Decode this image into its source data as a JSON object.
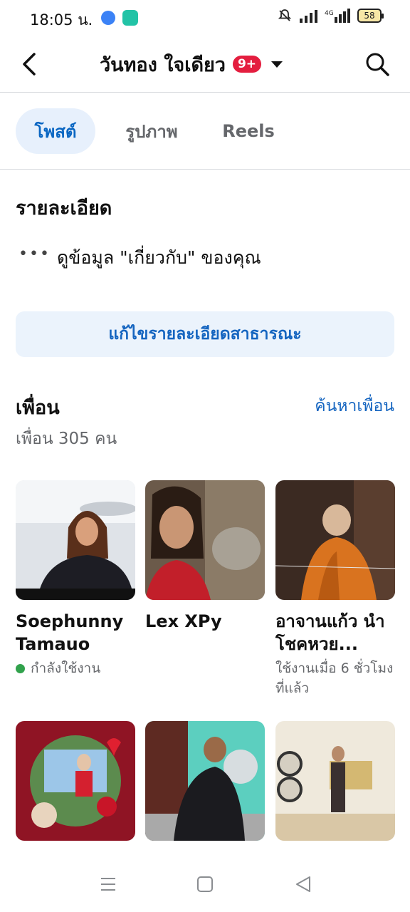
{
  "status": {
    "time": "18:05 น.",
    "battery": "58"
  },
  "header": {
    "title": "วันทอง ใจเดียว",
    "badge": "9+"
  },
  "tabs": [
    {
      "label": "โพสต์"
    },
    {
      "label": "รูปภาพ"
    },
    {
      "label": "Reels"
    }
  ],
  "details": {
    "title": "รายละเอียด",
    "more": "•••",
    "about_link": "ดูข้อมูล \"เกี่ยวกับ\" ของคุณ",
    "edit_button": "แก้ไขรายละเอียดสาธารณะ"
  },
  "friends": {
    "title": "เพื่อน",
    "find_link": "ค้นหาเพื่อน",
    "count": "เพื่อน 305 คน",
    "list": [
      {
        "name": "Soephunny Tamauo",
        "status": "กำลังใช้งาน",
        "online": true
      },
      {
        "name": "Lex XPy",
        "status": ""
      },
      {
        "name": "อาจานแก้ว นำโชคหวย...",
        "status": "ใช้งานเมื่อ 6 ชั่วโมงที่แล้ว"
      },
      {
        "name": "",
        "status": ""
      },
      {
        "name": "",
        "status": ""
      },
      {
        "name": "",
        "status": ""
      }
    ]
  },
  "colors": {
    "accent": "#1565c0",
    "badge": "#e41e3f",
    "online": "#31a24c"
  }
}
